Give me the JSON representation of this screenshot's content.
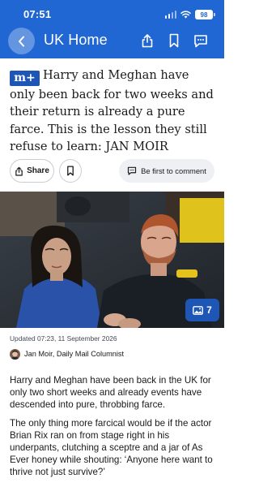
{
  "status": {
    "time": "07:51",
    "battery": "98"
  },
  "nav": {
    "title": "UK Home"
  },
  "article": {
    "premium_badge": "m+",
    "headline": "Harry and Meghan have only been back for two weeks and their return is already a pure farce. This is the lesson they still refuse to learn: JAN MOIR",
    "share_label": "Share",
    "comment_label": "Be first to comment",
    "gallery_count": "7",
    "updated": "Updated 07:23, 11 September 2026",
    "byline": "Jan Moir, Daily Mail Columnist",
    "paragraphs": [
      "Harry and Meghan have been back in the UK for only two short weeks and already events have descended into pure, throbbing farce.",
      "The only thing more farcical would be if the actor Brian Rix ran on from stage right in his underpants, clutching a sceptre and a jar of As Ever honey while shouting: ‘Anyone here want to thrive not just survive?’"
    ]
  },
  "colors": {
    "brand_blue": "#2167d3",
    "badge_blue": "#1d56b4"
  },
  "icons": [
    "back-arrow-icon",
    "share-icon",
    "bookmark-icon",
    "comments-icon",
    "gallery-icon",
    "signal-icon",
    "wifi-icon",
    "battery-icon"
  ]
}
